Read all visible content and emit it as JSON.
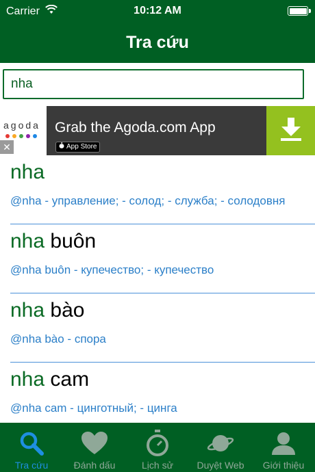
{
  "status": {
    "carrier": "Carrier",
    "time": "10:12 AM"
  },
  "nav": {
    "title": "Tra cứu"
  },
  "search": {
    "value": "nha"
  },
  "ad": {
    "logo_text": "agoda",
    "headline": "Grab the Agoda.com App",
    "badge": "App Store",
    "dot_colors": [
      "#e53935",
      "#f9a825",
      "#43a047",
      "#8e24aa",
      "#1e88e5"
    ]
  },
  "results": [
    {
      "prefix": "nha",
      "rest": "",
      "desc": "@nha - управление; - солод; - служба; - солодовня"
    },
    {
      "prefix": "nha",
      "rest": " buôn",
      "desc": "@nha buôn - купечество; - купечество"
    },
    {
      "prefix": "nha",
      "rest": " bào",
      "desc": "@nha bào - спора"
    },
    {
      "prefix": "nha",
      "rest": " cam",
      "desc": "@nha cam - цинготный; - цинга"
    }
  ],
  "tabs": [
    {
      "label": "Tra cứu",
      "icon": "search-icon",
      "active": true
    },
    {
      "label": "Đánh dấu",
      "icon": "heart-icon",
      "active": false
    },
    {
      "label": "Lịch sử",
      "icon": "stopwatch-icon",
      "active": false
    },
    {
      "label": "Duyệt Web",
      "icon": "planet-icon",
      "active": false
    },
    {
      "label": "Giới thiệu",
      "icon": "person-icon",
      "active": false
    }
  ],
  "colors": {
    "brand_green": "#005f23",
    "active_tab": "#1e8fe0",
    "link_blue": "#2b7fc8"
  }
}
